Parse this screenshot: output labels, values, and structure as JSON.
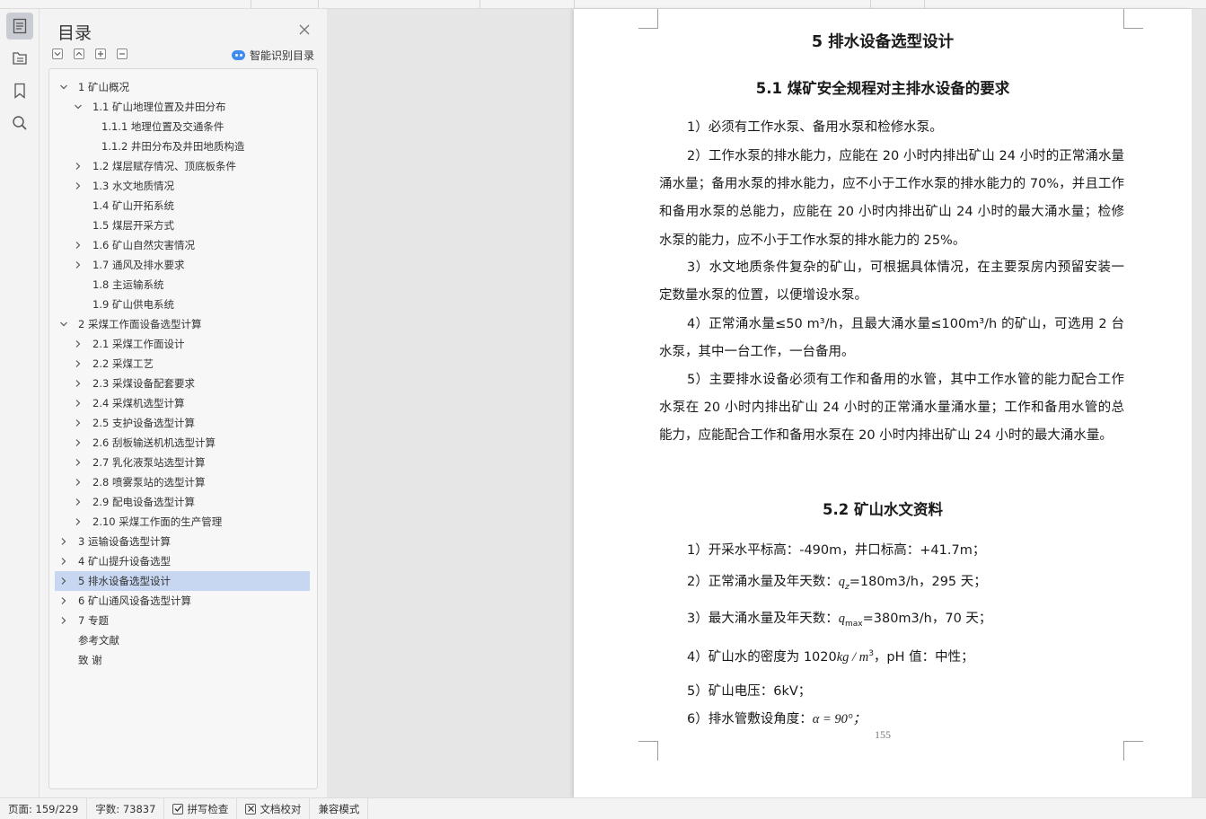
{
  "toc": {
    "title": "目录",
    "smart_label": "智能识别目录",
    "tools": [
      "collapse-all",
      "collapse-level",
      "expand-level",
      "remove"
    ],
    "items": [
      {
        "label": "1 矿山概况",
        "level": 0,
        "chevron": "down"
      },
      {
        "label": "1.1 矿山地理位置及井田分布",
        "level": 1,
        "chevron": "down"
      },
      {
        "label": "1.1.1 地理位置及交通条件",
        "level": 2,
        "chevron": "none"
      },
      {
        "label": "1.1.2 井田分布及井田地质构造",
        "level": 2,
        "chevron": "none"
      },
      {
        "label": "1.2 煤层赋存情况、顶底板条件",
        "level": 1,
        "chevron": "right"
      },
      {
        "label": "1.3 水文地质情况",
        "level": 1,
        "chevron": "right"
      },
      {
        "label": "1.4 矿山开拓系统",
        "level": 1,
        "chevron": "none"
      },
      {
        "label": "1.5 煤层开采方式",
        "level": 1,
        "chevron": "none"
      },
      {
        "label": "1.6 矿山自然灾害情况",
        "level": 1,
        "chevron": "right"
      },
      {
        "label": "1.7 通风及排水要求",
        "level": 1,
        "chevron": "right"
      },
      {
        "label": "1.8 主运输系统",
        "level": 1,
        "chevron": "none"
      },
      {
        "label": "1.9 矿山供电系统",
        "level": 1,
        "chevron": "none"
      },
      {
        "label": "2 采煤工作面设备选型计算",
        "level": 0,
        "chevron": "down"
      },
      {
        "label": "2.1 采煤工作面设计",
        "level": 1,
        "chevron": "right"
      },
      {
        "label": "2.2  采煤工艺",
        "level": 1,
        "chevron": "right"
      },
      {
        "label": "2.3 采煤设备配套要求",
        "level": 1,
        "chevron": "right"
      },
      {
        "label": "2.4  采煤机选型计算",
        "level": 1,
        "chevron": "right"
      },
      {
        "label": "2.5 支护设备选型计算",
        "level": 1,
        "chevron": "right"
      },
      {
        "label": "2.6 刮板输送机机选型计算",
        "level": 1,
        "chevron": "right"
      },
      {
        "label": "2.7  乳化液泵站选型计算",
        "level": 1,
        "chevron": "right"
      },
      {
        "label": "2.8 喷雾泵站的选型计算",
        "level": 1,
        "chevron": "right"
      },
      {
        "label": "2.9  配电设备选型计算",
        "level": 1,
        "chevron": "right"
      },
      {
        "label": "2.10 采煤工作面的生产管理",
        "level": 1,
        "chevron": "right"
      },
      {
        "label": "3 运输设备选型计算",
        "level": 0,
        "chevron": "right"
      },
      {
        "label": "4 矿山提升设备选型",
        "level": 0,
        "chevron": "right"
      },
      {
        "label": "5 排水设备选型设计",
        "level": 0,
        "chevron": "right",
        "selected": true
      },
      {
        "label": "6 矿山通风设备选型计算",
        "level": 0,
        "chevron": "right"
      },
      {
        "label": "7 专题",
        "level": 0,
        "chevron": "right"
      },
      {
        "label": "参考文献",
        "level": 0,
        "chevron": "none"
      },
      {
        "label": "致    谢",
        "level": 0,
        "chevron": "none"
      }
    ]
  },
  "rail": [
    "document-icon",
    "outline-icon",
    "bookmark-icon",
    "search-icon"
  ],
  "doc": {
    "h1": "5 排水设备选型设计",
    "h2a": "5.1  煤矿安全规程对主排水设备的要求",
    "p1": "1）必须有工作水泵、备用水泵和检修水泵。",
    "p2": "2）工作水泵的排水能力，应能在 20 小时内排出矿山 24 小时的正常涌水量涌水量；备用水泵的排水能力，应不小于工作水泵的排水能力的 70%，并且工作和备用水泵的总能力，应能在 20 小时内排出矿山 24 小时的最大涌水量；检修水泵的能力，应不小于工作水泵的排水能力的 25%。",
    "p3": "3）水文地质条件复杂的矿山，可根据具体情况，在主要泵房内预留安装一定数量水泵的位置，以便增设水泵。",
    "p4": "4）正常涌水量≤50 m³/h，且最大涌水量≤100m³/h 的矿山，可选用 2 台水泵，其中一台工作，一台备用。",
    "p5": "5）主要排水设备必须有工作和备用的水管，其中工作水管的能力配合工作水泵在 20 小时内排出矿山 24 小时的正常涌水量涌水量；工作和备用水管的总能力，应能配合工作和备用水泵在 20 小时内排出矿山 24 小时的最大涌水量。",
    "h2b": "5.2 矿山水文资料",
    "l1": "1）开采水平标高：-490m，井口标高：+41.7m；",
    "l2_pre": "2）正常涌水量及年天数：",
    "l2_var": "q",
    "l2_sub": "z",
    "l2_post": "=180m3/h，295 天；",
    "l3_pre": "3）最大涌水量及年天数：",
    "l3_var": "q",
    "l3_sub": "max",
    "l3_post": "=380m3/h，70 天；",
    "l4_pre": "4）矿山水的密度为 1020",
    "l4_unit": "kg / m",
    "l4_sup": "3",
    "l4_post": "，pH 值：中性；",
    "l5": "5）矿山电压：6kV；",
    "l6_pre": "6）排水管敷设角度：",
    "l6_val": "α = 90°；",
    "page_number": "155"
  },
  "status": {
    "page": "页面: 159/229",
    "words": "字数: 73837",
    "spell": "拼写检查",
    "proof": "文档校对",
    "compat": "兼容模式"
  }
}
